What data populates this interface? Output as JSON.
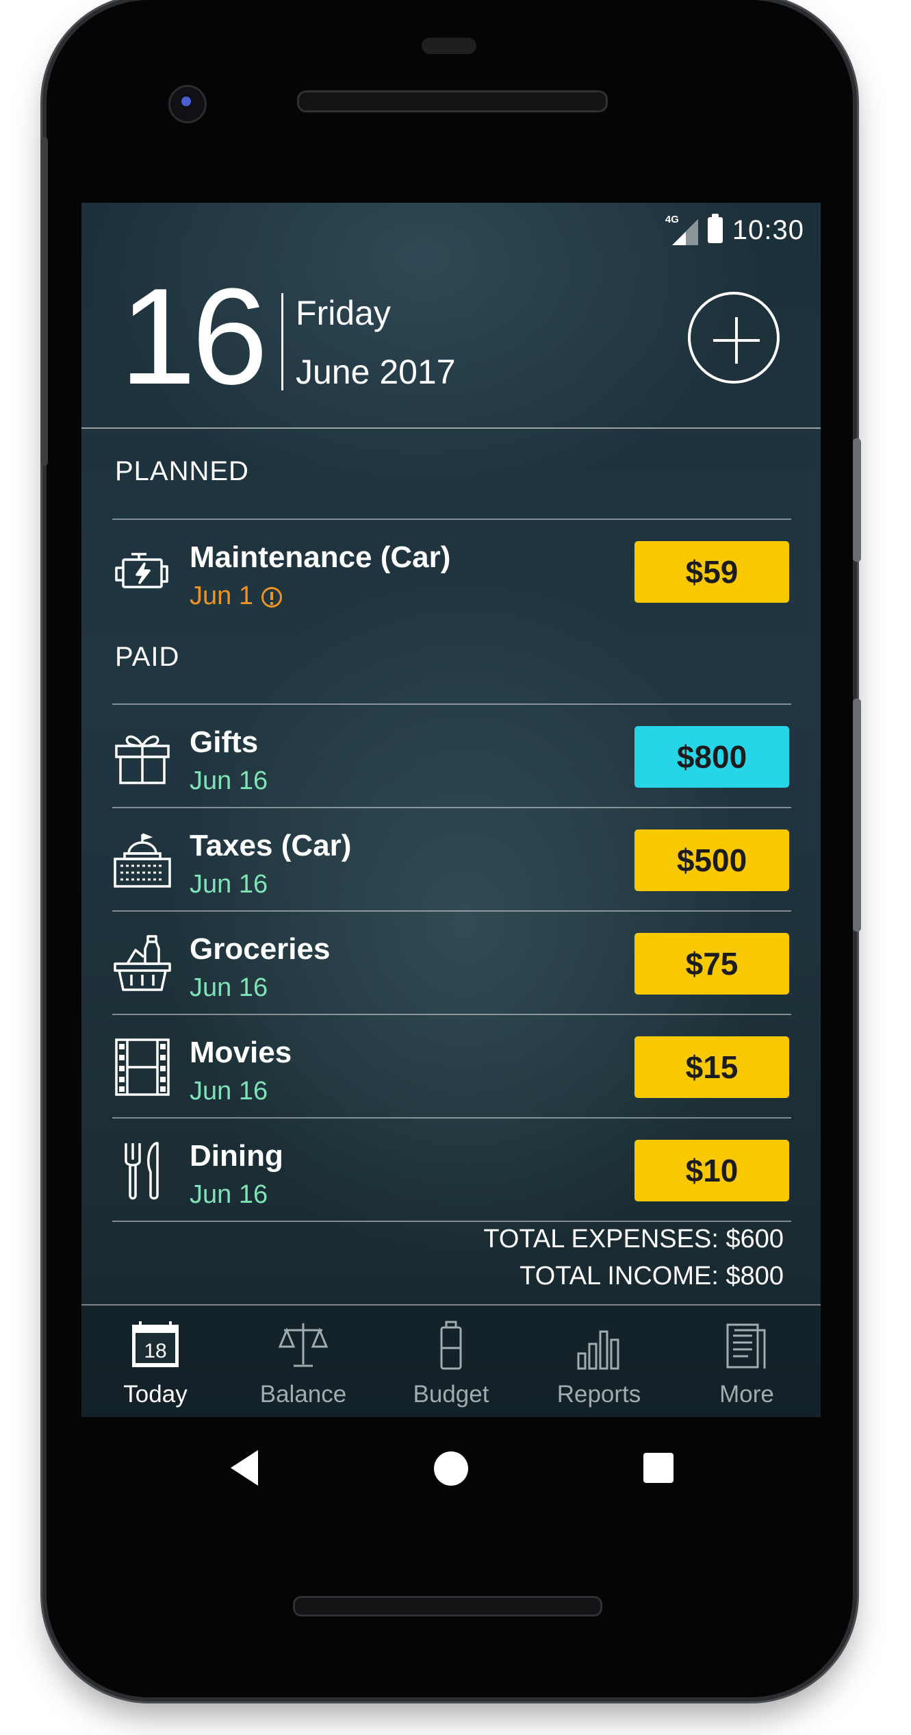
{
  "status_bar": {
    "network": "4G",
    "time": "10:30"
  },
  "header": {
    "day": "16",
    "weekday": "Friday",
    "month_year": "June 2017",
    "add_icon": "plus-circle-icon"
  },
  "sections": {
    "planned": {
      "label": "PLANNED",
      "items": [
        {
          "name": "Maintenance (Car)",
          "date": "Jun 1",
          "amount": "$59",
          "icon": "engine-icon",
          "date_color": "#f0921f",
          "amount_color": "#f8c800",
          "warning": true
        }
      ]
    },
    "paid": {
      "label": "PAID",
      "items": [
        {
          "name": "Gifts",
          "date": "Jun 16",
          "amount": "$800",
          "icon": "gift-icon",
          "amount_color": "#27d5e9"
        },
        {
          "name": "Taxes (Car)",
          "date": "Jun 16",
          "amount": "$500",
          "icon": "government-building-icon",
          "amount_color": "#f8c800"
        },
        {
          "name": "Groceries",
          "date": "Jun 16",
          "amount": "$75",
          "icon": "grocery-basket-icon",
          "amount_color": "#f8c800"
        },
        {
          "name": "Movies",
          "date": "Jun 16",
          "amount": "$15",
          "icon": "film-strip-icon",
          "amount_color": "#f8c800"
        },
        {
          "name": "Dining",
          "date": "Jun 16",
          "amount": "$10",
          "icon": "fork-knife-icon",
          "amount_color": "#f8c800"
        }
      ]
    }
  },
  "totals": {
    "expenses": "TOTAL EXPENSES: $600",
    "income": "TOTAL INCOME: $800"
  },
  "bottom_nav": {
    "tabs": [
      {
        "label": "Today",
        "icon": "calendar-icon",
        "calendar_day": "18",
        "active": true
      },
      {
        "label": "Balance",
        "icon": "scales-icon"
      },
      {
        "label": "Budget",
        "icon": "battery-icon"
      },
      {
        "label": "Reports",
        "icon": "bar-chart-icon"
      },
      {
        "label": "More",
        "icon": "documents-icon"
      }
    ]
  },
  "system_nav": {
    "back_icon": "back-triangle-icon",
    "home_icon": "home-circle-icon",
    "recents_icon": "recents-square-icon"
  }
}
